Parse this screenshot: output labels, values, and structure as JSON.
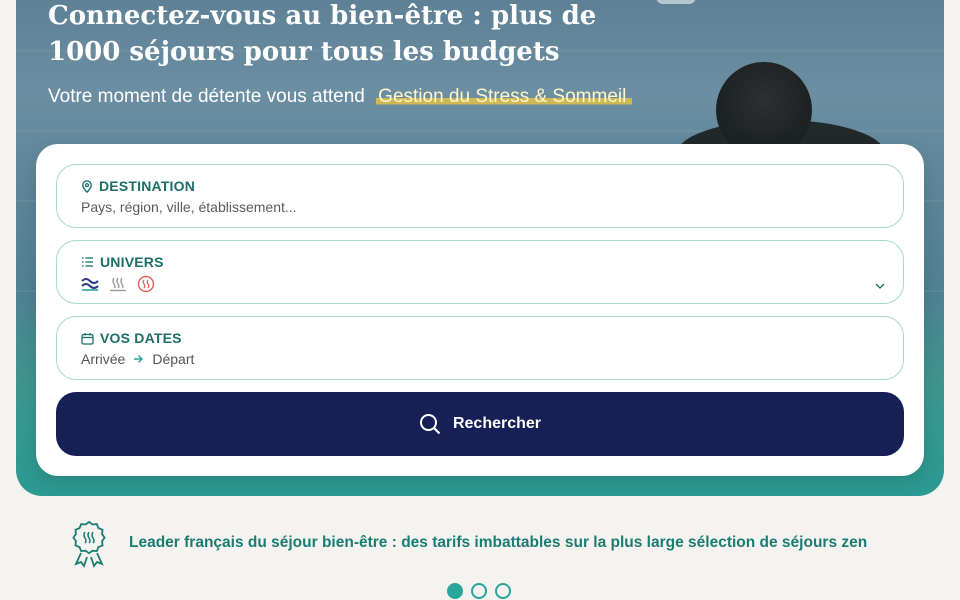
{
  "hero": {
    "title": "Connectez-vous au bien-être : plus de 1000 séjours pour tous les budgets",
    "subtitle": "Votre moment de détente vous attend",
    "tagline": "Gestion du Stress & Sommeil"
  },
  "search": {
    "destination": {
      "label": "DESTINATION",
      "placeholder": "Pays, région, ville, établissement...",
      "icon": "location-pin-icon"
    },
    "univers": {
      "label": "UNIVERS",
      "icon": "list-icon",
      "selected_icons": [
        "thalasso-icon",
        "spa-steam-icon",
        "massage-icon"
      ]
    },
    "dates": {
      "label": "VOS DATES",
      "icon": "calendar-icon",
      "arrival": "Arrivée",
      "departure": "Départ"
    },
    "button_label": "Rechercher"
  },
  "banner": {
    "text": "Leader français du séjour bien-être : des tarifs imbattables sur la plus large sélection de séjours zen",
    "icon": "award-ribbon-icon"
  },
  "carousel": {
    "count": 3,
    "active_index": 0
  },
  "colors": {
    "primary_navy": "#171f57",
    "teal": "#1b6f67",
    "accent_teal": "#2aa59b",
    "highlight": "#f0c83c"
  }
}
